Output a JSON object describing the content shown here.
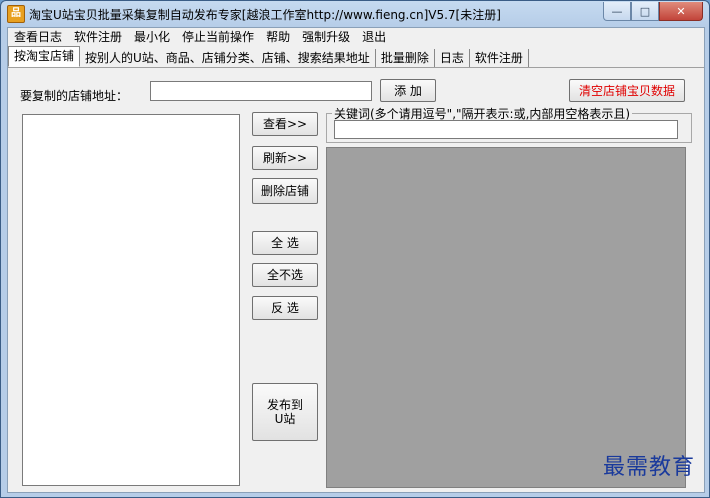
{
  "window": {
    "title": "淘宝U站宝贝批量采集复制自动发布专家[越浪工作室http://www.fieng.cn]V5.7[未注册]",
    "icon_label": "品"
  },
  "menu": [
    "查看日志",
    "软件注册",
    "最小化",
    "停止当前操作",
    "帮助",
    "强制升级",
    "退出"
  ],
  "tabs": [
    "按淘宝店铺",
    "按别人的U站、商品、店铺分类、店铺、搜索结果地址",
    "批量删除",
    "日志",
    "软件注册"
  ],
  "shop_url": {
    "label": "要复制的店铺地址：",
    "value": ""
  },
  "buttons": {
    "add": "添 加",
    "clear_data": "清空店铺宝贝数据",
    "view": "查看>>",
    "refresh": "刷新>>",
    "delete_shop": "删除店铺",
    "select_all": "全 选",
    "select_none": "全不选",
    "invert": "反 选",
    "publish": "发布到\nU站"
  },
  "keyword": {
    "label": "关键词(多个请用逗号\",\"隔开表示:或,内部用空格表示且)",
    "value": ""
  },
  "watermark": "最需教育",
  "colors": {
    "accent_red": "#e00000",
    "title_bar": "#c5daf0",
    "panel_grey": "#a0a0a0"
  }
}
